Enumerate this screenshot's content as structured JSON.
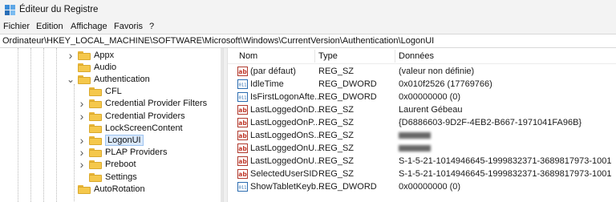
{
  "window": {
    "title": "Éditeur du Registre"
  },
  "menu": [
    "Fichier",
    "Edition",
    "Affichage",
    "Favoris",
    "?"
  ],
  "address": "Ordinateur\\HKEY_LOCAL_MACHINE\\SOFTWARE\\Microsoft\\Windows\\CurrentVersion\\Authentication\\LogonUI",
  "tree": [
    {
      "label": "Appx",
      "chevron": "right",
      "selected": false
    },
    {
      "label": "Audio",
      "chevron": "none",
      "selected": false
    },
    {
      "label": "Authentication",
      "chevron": "down",
      "selected": false
    },
    {
      "label": "CFL",
      "chevron": "none",
      "selected": false
    },
    {
      "label": "Credential Provider Filters",
      "chevron": "right",
      "selected": false
    },
    {
      "label": "Credential Providers",
      "chevron": "right",
      "selected": false
    },
    {
      "label": "LockScreenContent",
      "chevron": "none",
      "selected": false
    },
    {
      "label": "LogonUI",
      "chevron": "right",
      "selected": true
    },
    {
      "label": "PLAP Providers",
      "chevron": "right",
      "selected": false
    },
    {
      "label": "Preboot",
      "chevron": "right",
      "selected": false
    },
    {
      "label": "Settings",
      "chevron": "none",
      "selected": false
    },
    {
      "label": "AutoRotation",
      "chevron": "none",
      "selected": false
    }
  ],
  "columns": {
    "name": "Nom",
    "type": "Type",
    "data": "Données"
  },
  "values": [
    {
      "name": "(par défaut)",
      "type": "REG_SZ",
      "data": "(valeur non définie)",
      "icon": "string-value-icon",
      "hidden": false
    },
    {
      "name": "IdleTime",
      "type": "REG_DWORD",
      "data": "0x010f2526 (17769766)",
      "icon": "dword-value-icon",
      "hidden": false
    },
    {
      "name": "IsFirstLogonAfte...",
      "type": "REG_DWORD",
      "data": "0x00000000 (0)",
      "icon": "dword-value-icon",
      "hidden": false
    },
    {
      "name": "LastLoggedOnD...",
      "type": "REG_SZ",
      "data": "Laurent Gébeau",
      "icon": "string-value-icon",
      "hidden": false
    },
    {
      "name": "LastLoggedOnP...",
      "type": "REG_SZ",
      "data": "{D6886603-9D2F-4EB2-B667-1971041FA96B}",
      "icon": "string-value-icon",
      "hidden": false
    },
    {
      "name": "LastLoggedOnS...",
      "type": "REG_SZ",
      "data": "",
      "icon": "string-value-icon",
      "hidden": true
    },
    {
      "name": "LastLoggedOnU...",
      "type": "REG_SZ",
      "data": "",
      "icon": "string-value-icon",
      "hidden": true
    },
    {
      "name": "LastLoggedOnU...",
      "type": "REG_SZ",
      "data": "S-1-5-21-1014946645-1999832371-3689817973-1001",
      "icon": "string-value-icon",
      "hidden": false
    },
    {
      "name": "SelectedUserSID",
      "type": "REG_SZ",
      "data": "S-1-5-21-1014946645-1999832371-3689817973-1001",
      "icon": "string-value-icon",
      "hidden": false
    },
    {
      "name": "ShowTabletKeyb...",
      "type": "REG_DWORD",
      "data": "0x00000000 (0)",
      "icon": "dword-value-icon",
      "hidden": false
    }
  ]
}
